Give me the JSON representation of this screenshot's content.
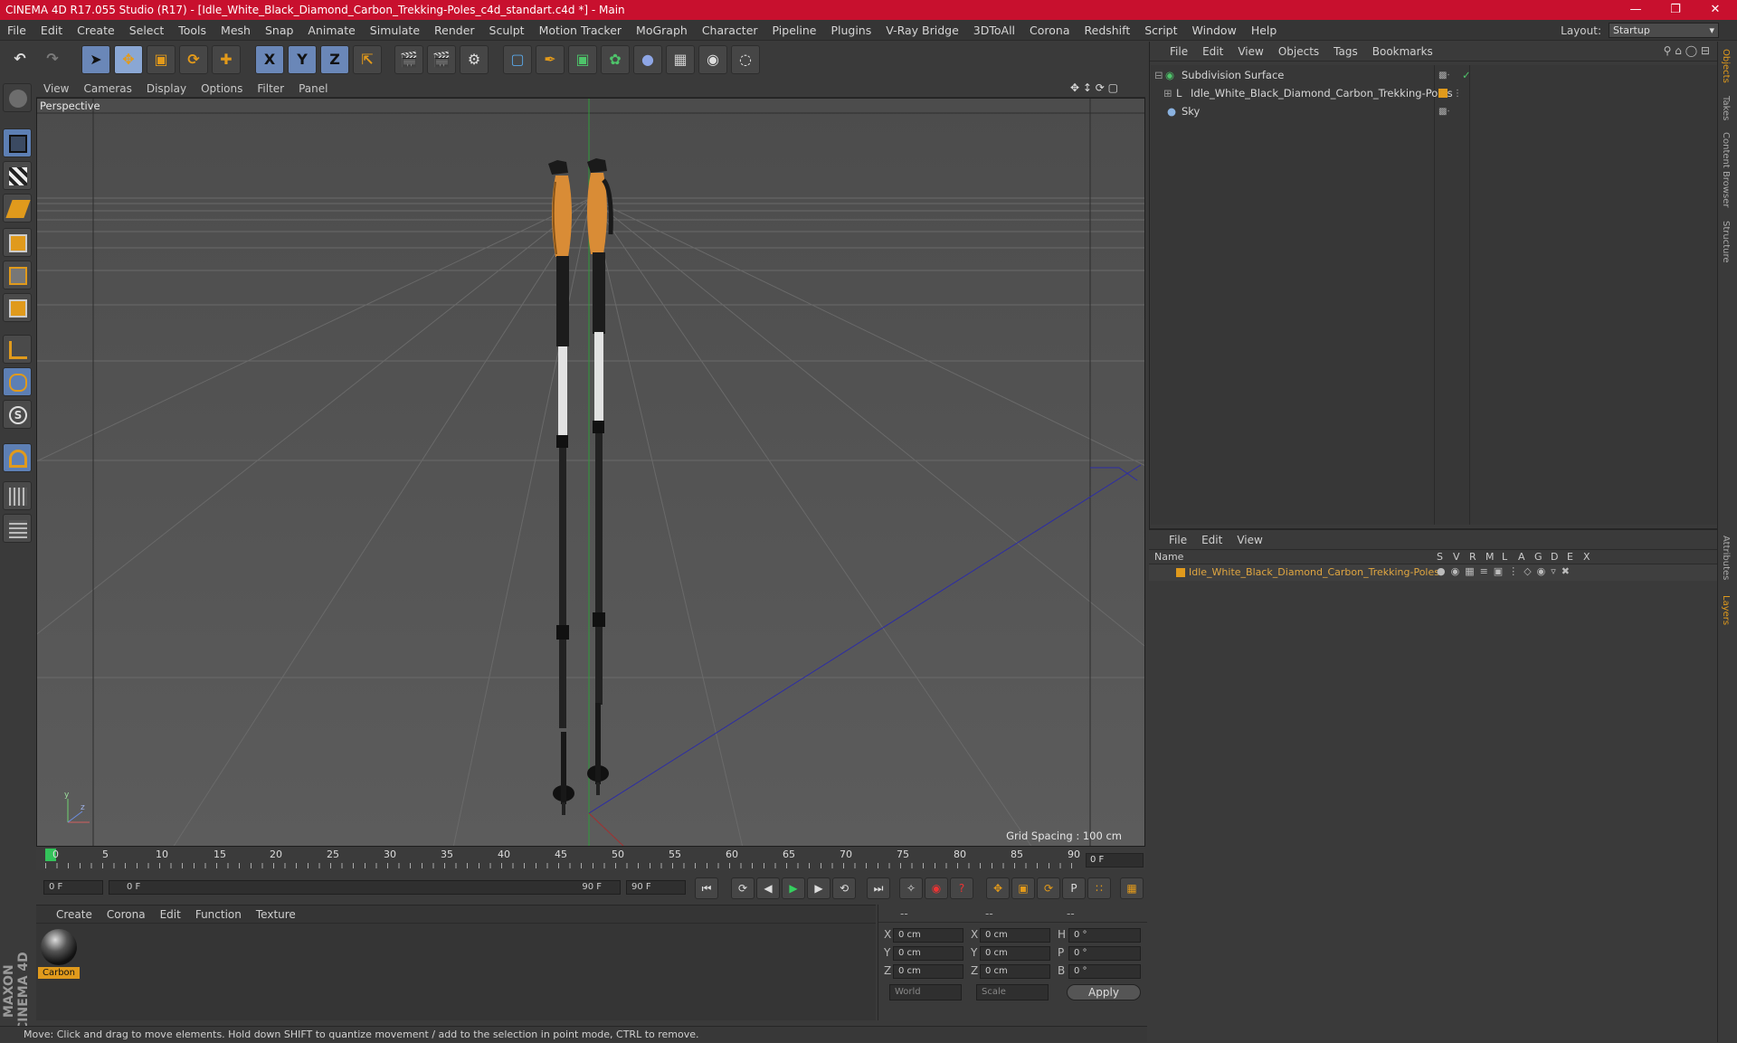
{
  "window": {
    "title": "CINEMA 4D R17.055 Studio (R17) - [Idle_White_Black_Diamond_Carbon_Trekking-Poles_c4d_standart.c4d *] - Main",
    "minimize_icon": "minimize-icon",
    "maximize_icon": "restore-icon",
    "close_icon": "close-icon"
  },
  "menubar": [
    "File",
    "Edit",
    "Create",
    "Select",
    "Tools",
    "Mesh",
    "Snap",
    "Animate",
    "Simulate",
    "Render",
    "Sculpt",
    "Motion Tracker",
    "MoGraph",
    "Character",
    "Pipeline",
    "Plugins",
    "V-Ray Bridge",
    "3DToAll",
    "Corona",
    "Redshift",
    "Script",
    "Window",
    "Help"
  ],
  "layout": {
    "label": "Layout:",
    "value": "Startup"
  },
  "toolbar": {
    "axis_x": "X",
    "axis_y": "Y",
    "axis_z": "Z"
  },
  "viewport": {
    "menu": [
      "View",
      "Cameras",
      "Display",
      "Options",
      "Filter",
      "Panel"
    ],
    "label": "Perspective",
    "grid_spacing": "Grid Spacing : 100 cm"
  },
  "timeline": {
    "ticks": [
      "0",
      "5",
      "10",
      "15",
      "20",
      "25",
      "30",
      "35",
      "40",
      "45",
      "50",
      "55",
      "60",
      "65",
      "70",
      "75",
      "80",
      "85",
      "90"
    ],
    "current_frame": "0 F",
    "start_field": "0 F",
    "range_start": "0 F",
    "range_end": "90 F",
    "end_field": "90 F"
  },
  "materials": {
    "menu": [
      "Create",
      "Corona",
      "Edit",
      "Function",
      "Texture"
    ],
    "items": [
      {
        "name": "Carbon"
      }
    ]
  },
  "coords": {
    "header": [
      "--",
      "--",
      "--"
    ],
    "rows": [
      {
        "a": "X",
        "av": "0 cm",
        "b": "X",
        "bv": "0 cm",
        "c": "H",
        "cv": "0 °"
      },
      {
        "a": "Y",
        "av": "0 cm",
        "b": "Y",
        "bv": "0 cm",
        "c": "P",
        "cv": "0 °"
      },
      {
        "a": "Z",
        "av": "0 cm",
        "b": "Z",
        "bv": "0 cm",
        "c": "B",
        "cv": "0 °"
      }
    ],
    "world": "World",
    "scale": "Scale",
    "apply": "Apply"
  },
  "objects": {
    "menu": [
      "File",
      "Edit",
      "View",
      "Objects",
      "Tags",
      "Bookmarks"
    ],
    "items": [
      {
        "name": "Subdivision Surface"
      },
      {
        "name": "Idle_White_Black_Diamond_Carbon_Trekking-Poles"
      },
      {
        "name": "Sky"
      }
    ]
  },
  "layers": {
    "menu": [
      "File",
      "Edit",
      "View"
    ],
    "columns": {
      "name": "Name",
      "flags": [
        "S",
        "V",
        "R",
        "M",
        "L",
        "A",
        "G",
        "D",
        "E",
        "X"
      ]
    },
    "items": [
      {
        "name": "Idle_White_Black_Diamond_Carbon_Trekking-Poles",
        "color": "#e09a1c"
      }
    ]
  },
  "side_tabs": [
    "Objects",
    "Takes",
    "Content Browser",
    "Structure",
    "Attributes",
    "Layers"
  ],
  "status": "Move: Click and drag to move elements. Hold down SHIFT to quantize movement / add to the selection in point mode, CTRL to remove.",
  "brand": "MAXON CINEMA 4D",
  "colors": {
    "accent": "#c8102e",
    "highlight": "#e09a1c",
    "selection_blue": "#5d7fb4"
  }
}
